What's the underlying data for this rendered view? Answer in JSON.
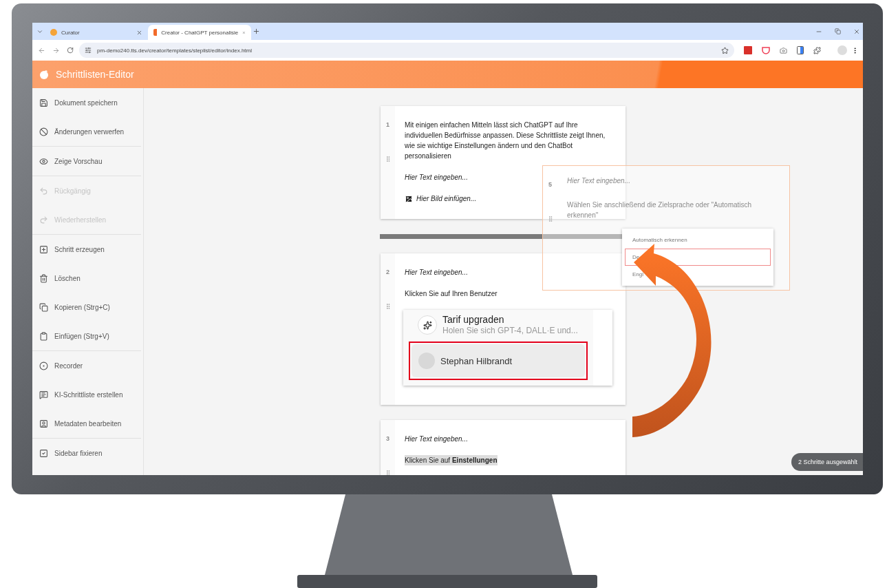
{
  "browser": {
    "tabs": [
      {
        "title": "Curator",
        "selected": false
      },
      {
        "title": "Creator - ChatGPT personalisie",
        "selected": true
      }
    ],
    "url": "pm-demo240.tts.dev/creator/templates/steplist/editor/index.html"
  },
  "app": {
    "title": "Schrittlisten-Editor"
  },
  "sidebar": {
    "groups": [
      [
        {
          "label": "Dokument speichern",
          "disabled": false
        },
        {
          "label": "Änderungen verwerfen",
          "disabled": false
        }
      ],
      [
        {
          "label": "Zeige Vorschau",
          "disabled": false
        }
      ],
      [
        {
          "label": "Rückgängig",
          "disabled": true
        },
        {
          "label": "Wiederherstellen",
          "disabled": true
        }
      ],
      [
        {
          "label": "Schritt erzeugen",
          "disabled": false
        },
        {
          "label": "Löschen",
          "disabled": false
        },
        {
          "label": "Kopieren (Strg+C)",
          "disabled": false
        },
        {
          "label": "Einfügen (Strg+V)",
          "disabled": false
        }
      ],
      [
        {
          "label": "Recorder",
          "disabled": false
        },
        {
          "label": "KI-Schrittliste erstellen",
          "disabled": false
        },
        {
          "label": "Metadaten bearbeiten",
          "disabled": false
        }
      ]
    ],
    "pin": {
      "label": "Sidebar fixieren",
      "checked": true
    }
  },
  "steps": [
    {
      "number": "1",
      "blocks": [
        {
          "kind": "text",
          "text": "Mit einigen einfachen Mitteln lässt sich ChatGPT auf Ihre individuellen Bedürfnisse anpassen. Diese Schrittliste zeigt Ihnen, wie sie wichtige Einstellungen ändern und den ChatBot personalisieren"
        },
        {
          "kind": "placeholder",
          "text": "Hier Text eingeben..."
        },
        {
          "kind": "image_placeholder",
          "text": "Hier Bild einfügen..."
        }
      ]
    },
    {
      "number": "2",
      "blocks": [
        {
          "kind": "placeholder",
          "text": "Hier Text eingeben..."
        },
        {
          "kind": "text",
          "text": "Klicken Sie auf Ihren Benutzer"
        },
        {
          "kind": "screenshot",
          "title": "Tarif upgraden",
          "subtitle": "Holen Sie sich GPT-4, DALL·E und...",
          "user": "Stephan Hilbrandt"
        }
      ]
    },
    {
      "number": "3",
      "blocks": [
        {
          "kind": "placeholder",
          "text": "Hier Text eingeben..."
        },
        {
          "kind": "highlighted_text",
          "text": "Klicken Sie auf **Einstellungen**"
        }
      ]
    }
  ],
  "dragged_step": {
    "number": "5",
    "placeholder": "Hier Text eingeben...",
    "text": "Wählen Sie anschließend die Zielsprache oder \"Automatisch erkennen\"",
    "options": [
      {
        "label": "Automatisch erkennen",
        "selected": false
      },
      {
        "label": "De",
        "selected": true
      },
      {
        "label": "Engl",
        "selected": false
      }
    ]
  },
  "selection_badge": "2 Schritte ausgewählt"
}
